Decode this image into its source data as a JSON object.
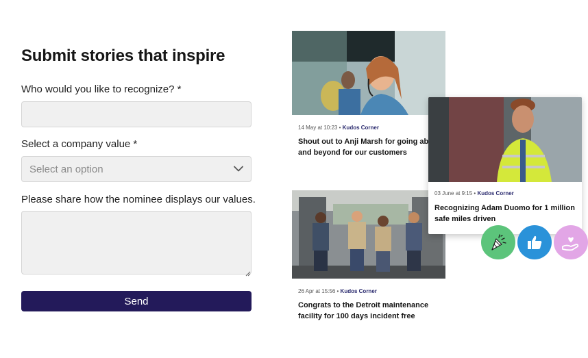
{
  "form": {
    "title": "Submit stories that inspire",
    "recognize_label": "Who would you like to recognize? *",
    "recognize_value": "",
    "company_value_label": "Select a company value *",
    "company_value_placeholder": "Select an option",
    "values_label": "Please share how the nominee displays our values.",
    "send_label": "Send"
  },
  "cards": [
    {
      "date": "14 May at 10:23",
      "separator": "•",
      "source": "Kudos Corner",
      "title": "Shout out to Anji Marsh for going above and beyond for our customers",
      "image": "call-center-agent-photo"
    },
    {
      "date": "26 Apr at 15:56",
      "separator": "•",
      "source": "Kudos Corner",
      "title": "Congrats to the Detroit maintenance facility for 100 days incident free",
      "image": "maintenance-team-photo"
    },
    {
      "date": "03 June at 9:15",
      "separator": "•",
      "source": "Kudos Corner",
      "title": "Recognizing Adam Duomo for 1 million safe miles driven",
      "image": "truck-driver-photo"
    }
  ],
  "reactions": [
    {
      "icon": "party-popper-icon",
      "color": "#5cc47b"
    },
    {
      "icon": "thumbs-up-icon",
      "color": "#2a92d9"
    },
    {
      "icon": "heart-hand-icon",
      "color": "#e2a6e6"
    }
  ]
}
